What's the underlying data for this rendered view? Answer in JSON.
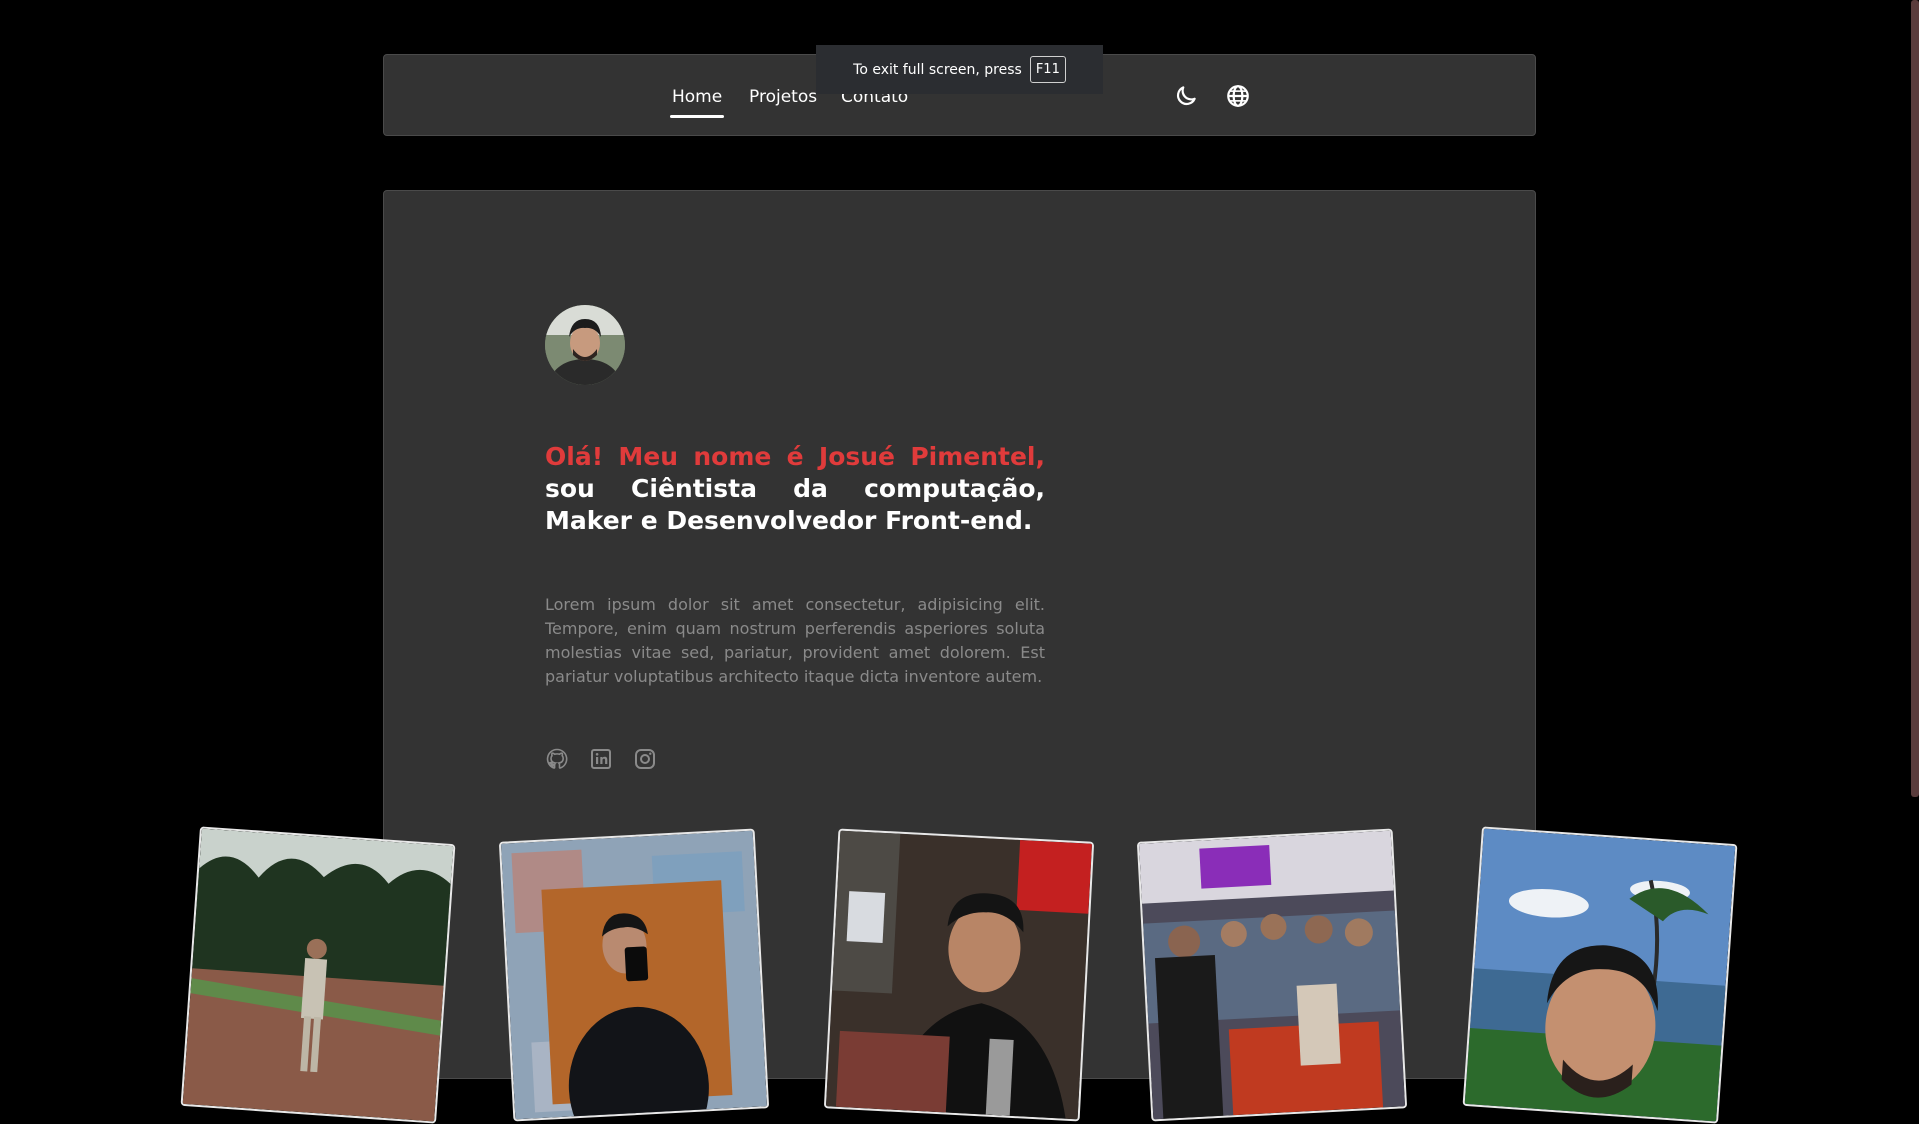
{
  "nav": {
    "links": [
      "Home",
      "Projetos",
      "Contato"
    ],
    "active": "Home",
    "icons": [
      "moon-icon",
      "globe-icon"
    ]
  },
  "fullscreen_notice": {
    "text": "To exit full screen, press",
    "key": "F11"
  },
  "hero": {
    "greeting": "Olá! Meu nome é Josué Pimentel,",
    "headline_rest": "sou Ciêntista da computação, Maker e Desenvolvedor Front-end.",
    "intro": "Lorem ipsum dolor sit amet consectetur, adipisicing elit. Tempore, enim quam nostrum perferendis asperiores soluta molestias vitae sed, pariatur, provident amet dolorem. Est pariatur voluptatibus architecto itaque dicta inventore autem.",
    "socials": [
      "github-icon",
      "linkedin-icon",
      "instagram-icon"
    ]
  },
  "photos": [
    {
      "name": "photo-park"
    },
    {
      "name": "photo-mirror-selfie"
    },
    {
      "name": "photo-laptop-event"
    },
    {
      "name": "photo-workshop"
    },
    {
      "name": "photo-lakeside-selfie"
    }
  ],
  "colors": {
    "background": "#000000",
    "card": "#333333",
    "accent": "#e03b3b",
    "muted_text": "#8a8a8a"
  }
}
